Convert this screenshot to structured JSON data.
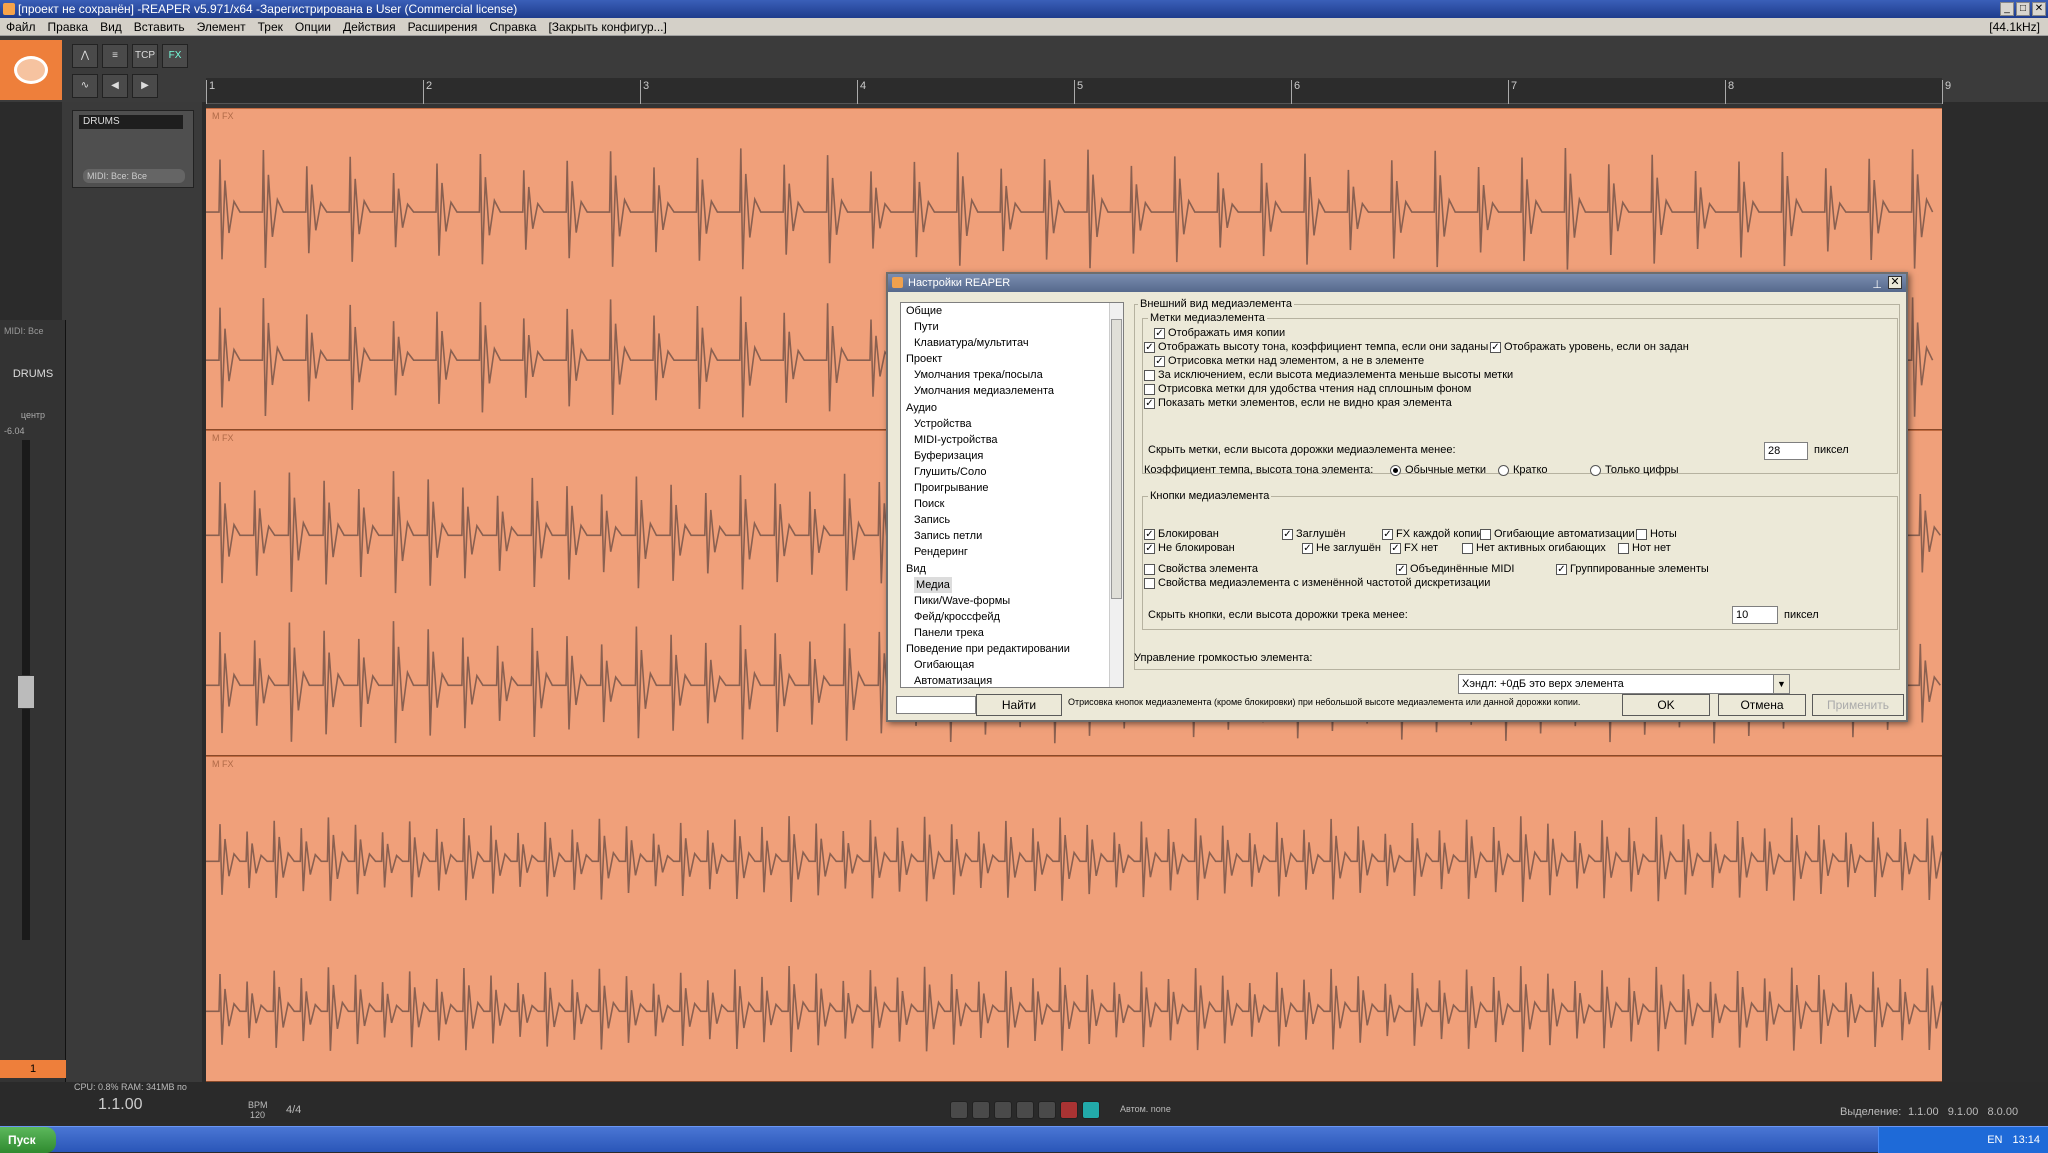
{
  "window": {
    "title": "[проект не сохранён] -REAPER v5.971/x64 -Зарегистрирована в User (Commercial license)"
  },
  "menu": {
    "items": [
      "Файл",
      "Правка",
      "Вид",
      "Вставить",
      "Элемент",
      "Трек",
      "Опции",
      "Действия",
      "Расширения",
      "Справка",
      "[Закрыть конфигур...]"
    ],
    "sample_rate": "[44.1kHz]"
  },
  "toolbar": {
    "tcp_label": "TCP",
    "fx_label": "FX"
  },
  "ruler": {
    "marks": [
      "1",
      "2",
      "3",
      "4",
      "5",
      "6",
      "7",
      "8",
      "9"
    ]
  },
  "track": {
    "name": "DRUMS",
    "midi_input": "MIDI: Все: Все",
    "mcp_name": "DRUMS",
    "mcp_midi": "MIDI: Все",
    "pan": "центр",
    "volume_db": "-6.04",
    "track_number": "1"
  },
  "lane_header": "M FX",
  "status": {
    "cpu": "CPU: 0.8% RAM: 341MB по",
    "position": "1.1.00",
    "bpm_label": "BPM",
    "bpm": "120",
    "meter": "4/4",
    "selection_label": "Выделение:",
    "selection": "1.1.00   9.1.00   8.0.00",
    "autom": "Автом. none"
  },
  "dialog": {
    "title": "Настройки REAPER",
    "tree": [
      {
        "label": "Общие",
        "sub": false
      },
      {
        "label": "Пути",
        "sub": true
      },
      {
        "label": "Клавиатура/мультитач",
        "sub": true
      },
      {
        "label": "Проект",
        "sub": false
      },
      {
        "label": "Умолчания трека/посыла",
        "sub": true
      },
      {
        "label": "Умолчания медиаэлемента",
        "sub": true
      },
      {
        "label": "Аудио",
        "sub": false
      },
      {
        "label": "Устройства",
        "sub": true
      },
      {
        "label": "MIDI-устройства",
        "sub": true
      },
      {
        "label": "Буферизация",
        "sub": true
      },
      {
        "label": "Глушить/Соло",
        "sub": true
      },
      {
        "label": "Проигрывание",
        "sub": true
      },
      {
        "label": "Поиск",
        "sub": true
      },
      {
        "label": "Запись",
        "sub": true
      },
      {
        "label": "Запись петли",
        "sub": true
      },
      {
        "label": "Рендеринг",
        "sub": true
      },
      {
        "label": "Вид",
        "sub": false
      },
      {
        "label": "Медиа",
        "sub": true,
        "selected": true
      },
      {
        "label": "Пики/Wave-формы",
        "sub": true
      },
      {
        "label": "Фейд/кроссфейд",
        "sub": true
      },
      {
        "label": "Панели трека",
        "sub": true
      },
      {
        "label": "Поведение при редактировании",
        "sub": false
      },
      {
        "label": "Огибающая",
        "sub": true
      },
      {
        "label": "Автоматизация",
        "sub": true
      }
    ],
    "find_button": "Найти",
    "hint": "Отрисовка кнопок медиаэлемента (кроме блокировки) при небольшой высоте медиаэлемента или данной дорожки копии.",
    "ok": "OK",
    "cancel": "Отмена",
    "apply": "Применить",
    "section_title": "Внешний вид медиаэлемента",
    "labels_group": "Метки медиаэлемента",
    "labels": [
      {
        "text": "Отображать имя копии",
        "checked": true
      },
      {
        "text": "Отображать высоту тона, коэффициент темпа, если они заданы",
        "checked": true
      },
      {
        "text": "Отображать уровень, если он задан",
        "checked": true
      },
      {
        "text": "Отрисовка метки над элементом, а не в элементе",
        "checked": true
      },
      {
        "text": "За исключением, если высота медиаэлемента меньше высоты метки",
        "checked": false
      },
      {
        "text": "Отрисовка метки для удобства чтения над сплошным фоном",
        "checked": false
      },
      {
        "text": "Показать метки элементов, если не видно края элемента",
        "checked": true
      }
    ],
    "hide_labels_text": "Скрыть метки, если высота дорожки медиаэлемента менее:",
    "hide_labels_value": "28",
    "pixels": "пиксел",
    "tempo_text": "Коэффициент темпа, высота тона элемента:",
    "tempo_options": [
      {
        "text": "Обычные метки",
        "selected": true
      },
      {
        "text": "Кратко",
        "selected": false
      },
      {
        "text": "Только цифры",
        "selected": false
      }
    ],
    "buttons_group": "Кнопки медиаэлемента",
    "buttons": [
      {
        "text": "Блокирован",
        "checked": true
      },
      {
        "text": "Заглушён",
        "checked": true
      },
      {
        "text": "FX каждой копии",
        "checked": true
      },
      {
        "text": "Огибающие автоматизации",
        "checked": false
      },
      {
        "text": "Ноты",
        "checked": false
      },
      {
        "text": "Не блокирован",
        "checked": true
      },
      {
        "text": "Не заглушён",
        "checked": true
      },
      {
        "text": "FX нет",
        "checked": true
      },
      {
        "text": "Нет активных огибающих",
        "checked": false
      },
      {
        "text": "Нот нет",
        "checked": false
      },
      {
        "text": "Свойства элемента",
        "checked": false
      },
      {
        "text": "Объединённые MIDI",
        "checked": true
      },
      {
        "text": "Группированные элементы",
        "checked": true
      },
      {
        "text": "Свойства медиаэлемента с изменённой частотой дискретизации",
        "checked": false
      }
    ],
    "hide_buttons_text": "Скрыть кнопки, если высота дорожки трека менее:",
    "hide_buttons_value": "10",
    "volume_text": "Управление громкостью элемента:",
    "volume_value": "Хэндл: +0дБ это верх элемента"
  },
  "taskbar": {
    "start": "Пуск",
    "lang": "EN",
    "time": "13:14"
  },
  "colors": {
    "lane": "#f0a07a",
    "wave": "#8a6050",
    "accent": "#ee7f3b"
  }
}
